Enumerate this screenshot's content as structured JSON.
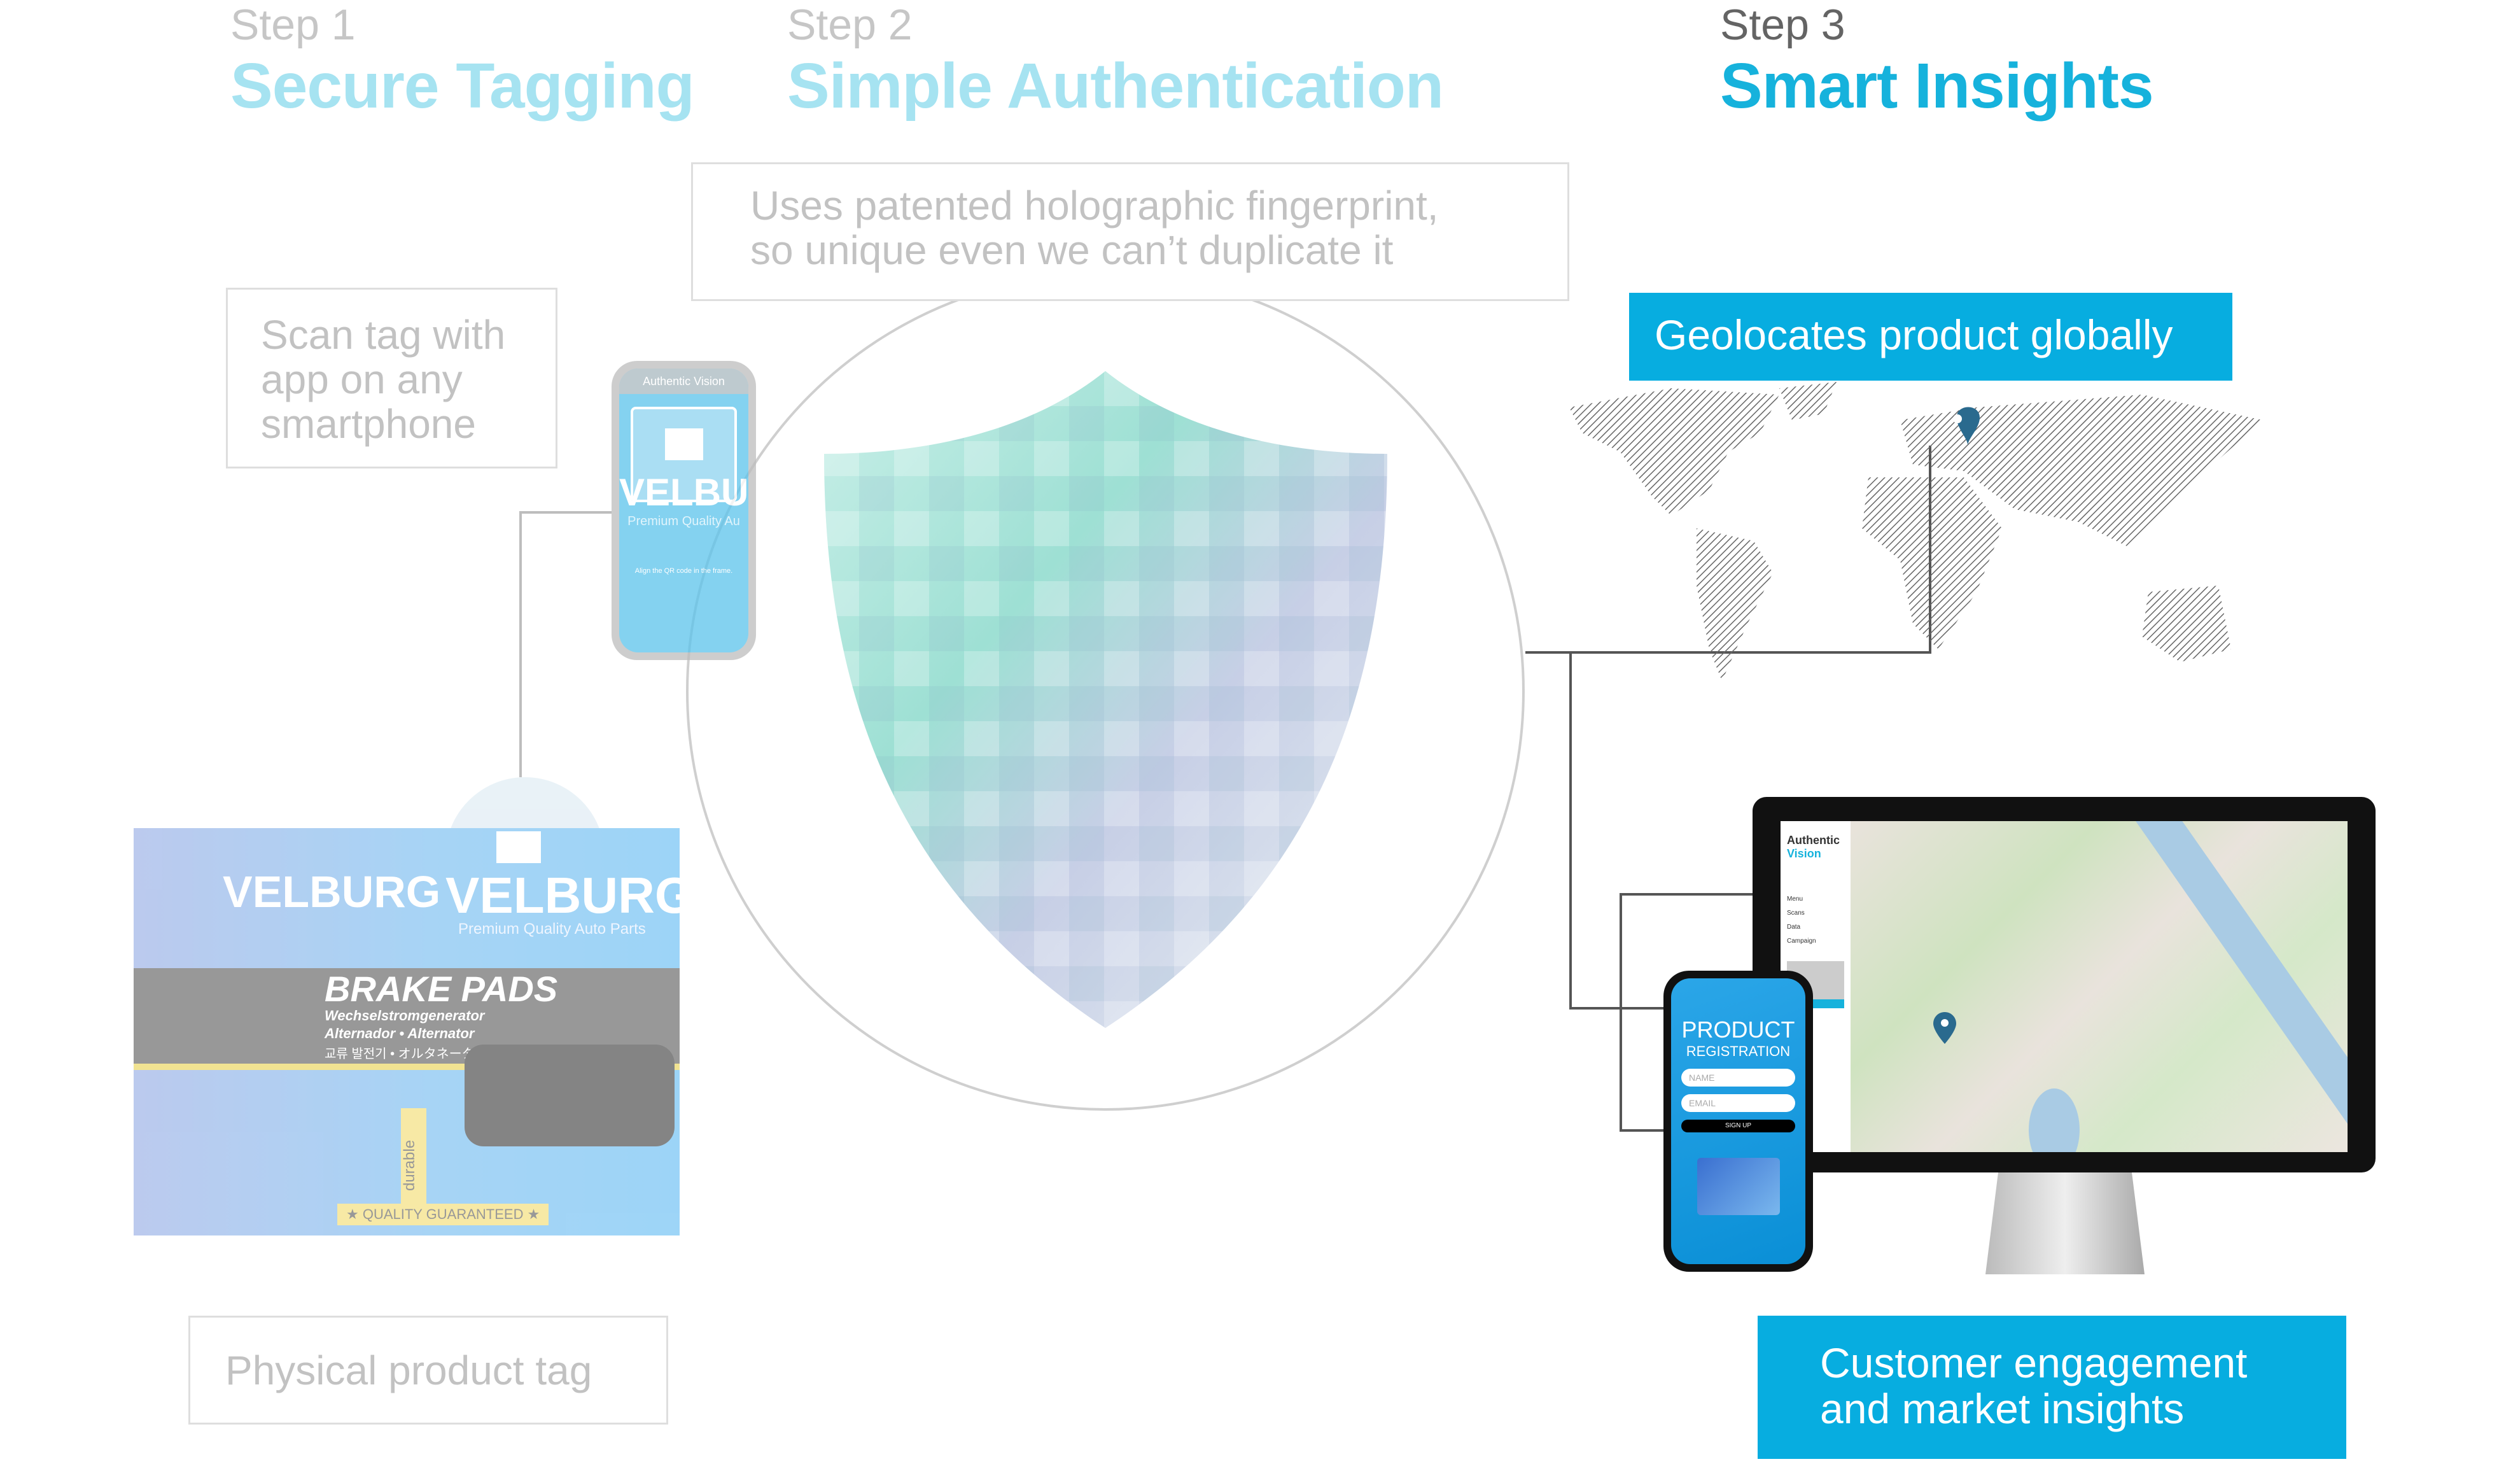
{
  "steps": [
    {
      "label": "Step 1",
      "title": "Secure Tagging"
    },
    {
      "label": "Step 2",
      "title": "Simple Authentication"
    },
    {
      "label": "Step 3",
      "title": "Smart Insights"
    }
  ],
  "callouts": {
    "hologram": [
      "Uses patented holographic fingerprint,",
      "so unique even we can’t duplicate it"
    ],
    "scan": [
      "Scan tag with",
      "app on any",
      "smartphone"
    ],
    "physical_tag": "Physical product tag",
    "geolocate": "Geolocates product globally",
    "engagement": [
      "Customer engagement",
      "and market insights"
    ]
  },
  "scan_phone": {
    "brand": "Authentic Vision",
    "watermark": "VELBU",
    "tagline": "Premium Quality Au",
    "hint": "Align the QR code in the frame."
  },
  "product_box": {
    "brand": "VELBURG",
    "tagline": "Premium Quality Auto Parts",
    "product": "BRAKE PADS",
    "line1": "Wechselstromgenerator",
    "line2": "Alternador • Alternator",
    "line3": "교류 발전기 • オルタネーター",
    "badge": "durable",
    "guarantee": "★ QUALITY GUARANTEED ★"
  },
  "dashboard": {
    "brand_1": "Authentic",
    "brand_2": "Vision",
    "menu": [
      "Menu",
      "Scans",
      "Data",
      "Campaign"
    ]
  },
  "registration_phone": {
    "title": "PRODUCT",
    "subtitle": "REGISTRATION",
    "name_placeholder": "NAME",
    "email_placeholder": "EMAIL",
    "button": "SIGN UP"
  },
  "colors": {
    "accent": "#07ade0",
    "faded_accent": "#a6e3f1",
    "pin": "#2a6a8e",
    "connector": "#555555"
  }
}
